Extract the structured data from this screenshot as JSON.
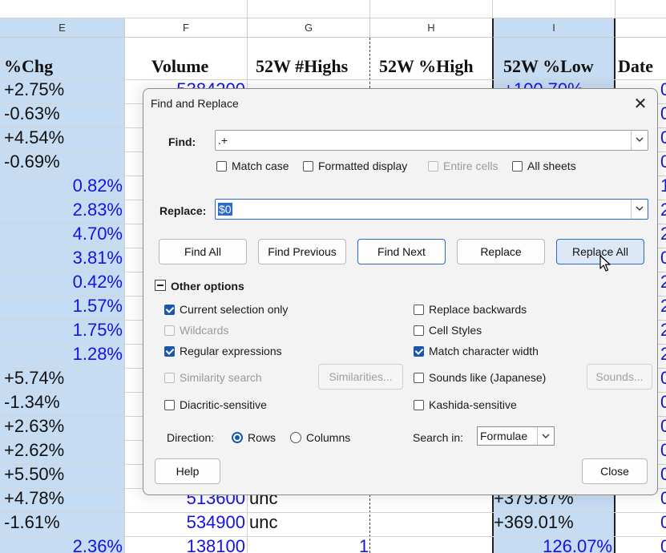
{
  "sheet": {
    "columns": [
      "E",
      "F",
      "G",
      "H",
      "I"
    ],
    "headers": [
      "%Chg",
      "Volume",
      "52W #Highs",
      "52W %High",
      "52W %Low",
      "Date"
    ],
    "chg_values": [
      "+2.75%",
      "-0.63%",
      "+4.54%",
      "-0.69%",
      "0.82%",
      "2.83%",
      "4.70%",
      "3.81%",
      "0.42%",
      "1.57%",
      "1.75%",
      "1.28%",
      "+5.74%",
      "-1.34%",
      "+2.63%",
      "+2.62%",
      "+5.50%",
      "+4.78%",
      "-1.61%",
      "2.36%"
    ],
    "volume_top": "5384200",
    "volume_bottom": [
      "513600",
      "534900",
      "138100"
    ],
    "highs_bottom": [
      "unc",
      "unc",
      "1"
    ],
    "low_top": "+100.70%",
    "low_bottom": [
      "+379.87%",
      "+369.01%",
      "126.07%"
    ],
    "date_partial": [
      "0",
      "0",
      "0",
      "0",
      "1",
      "2",
      "2",
      "0",
      "2",
      "2",
      "2",
      "2",
      "0",
      "0",
      "0",
      "0",
      "0",
      "0",
      "0",
      "0"
    ]
  },
  "dialog": {
    "title": "Find and Replace",
    "find_label": "Find:",
    "find_value": ".+",
    "replace_label": "Replace:",
    "replace_value": "$0",
    "opt_match_case": "Match case",
    "opt_formatted": "Formatted display",
    "opt_entire_cells": "Entire cells",
    "opt_all_sheets": "All sheets",
    "btn_find_all": "Find All",
    "btn_find_previous": "Find Previous",
    "btn_find_next": "Find Next",
    "btn_replace": "Replace",
    "btn_replace_all": "Replace All",
    "other_options": "Other options",
    "opt_current_selection": "Current selection only",
    "opt_replace_backwards": "Replace backwards",
    "opt_wildcards": "Wildcards",
    "opt_cell_styles": "Cell Styles",
    "opt_regex": "Regular expressions",
    "opt_match_width": "Match character width",
    "opt_similarity": "Similarity search",
    "btn_similarities": "Similarities...",
    "opt_sounds_like": "Sounds like (Japanese)",
    "btn_sounds": "Sounds...",
    "opt_diacritic": "Diacritic-sensitive",
    "opt_kashida": "Kashida-sensitive",
    "direction_label": "Direction:",
    "dir_rows": "Rows",
    "dir_columns": "Columns",
    "search_in_label": "Search in:",
    "search_in_value": "Formulae",
    "btn_help": "Help",
    "btn_close": "Close"
  },
  "colors": {
    "selection": "#c6dcf2",
    "blue_text": "#1414e0",
    "accent": "#1a55b0"
  }
}
